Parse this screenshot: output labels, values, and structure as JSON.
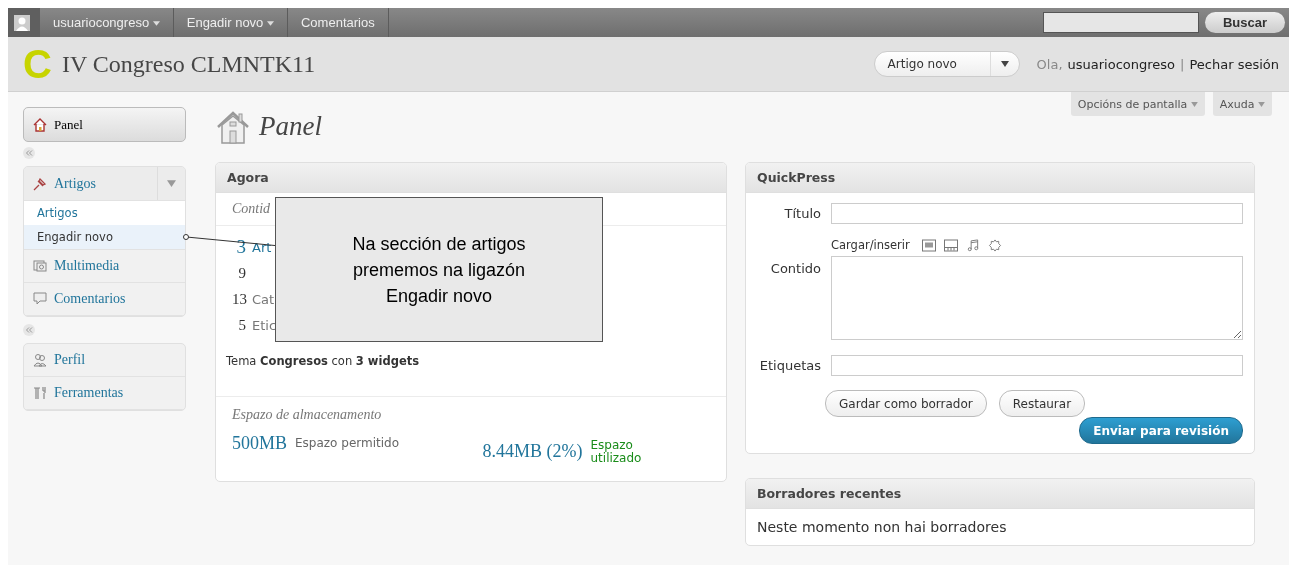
{
  "admin_bar": {
    "user": "usuariocongreso",
    "menus": [
      {
        "label": "Engadir novo",
        "dropdown": true
      },
      {
        "label": "Comentarios",
        "dropdown": false
      }
    ],
    "search_button": "Buscar"
  },
  "header": {
    "logo": "C",
    "site_title": "IV Congreso CLMNTK11",
    "quick_action": "Artigo novo",
    "greeting": "Ola,",
    "user": "usuariocongreso",
    "separator": "|",
    "logout": "Pechar sesión"
  },
  "screen_tabs": [
    "Opcións de pantalla",
    "Axuda"
  ],
  "page_title": "Panel",
  "sidebar": {
    "panel": {
      "label": "Panel",
      "selected": true
    },
    "groups": [
      [
        {
          "label": "Artigos",
          "kind": "pin",
          "expanded": true,
          "children": [
            {
              "label": "Artigos",
              "selected": false
            },
            {
              "label": "Engadir novo",
              "selected": true
            }
          ]
        },
        {
          "label": "Multimedia",
          "kind": "media",
          "expanded": false
        },
        {
          "label": "Comentarios",
          "kind": "comment",
          "expanded": false
        }
      ],
      [
        {
          "label": "Perfil",
          "kind": "users",
          "expanded": false
        },
        {
          "label": "Ferramentas",
          "kind": "tools",
          "expanded": false
        }
      ]
    ]
  },
  "agora": {
    "title": "Agora",
    "subtitle": "Contid",
    "rows": [
      {
        "count": "3",
        "label": "Art",
        "big": true
      },
      {
        "count": "9",
        "big": false
      },
      {
        "count": "13",
        "label": "Cat",
        "big": false
      },
      {
        "count": "5",
        "label": "Etic",
        "big": false
      }
    ],
    "theme": "Tema **Congresos** con **3 widgets**",
    "storage_title": "Espazo de almacenamento",
    "allowed": "500MB",
    "allowed_label": "Espazo permitido",
    "used": "8.44MB (2%)",
    "used_label": [
      "Espazo",
      "utilizado"
    ]
  },
  "callout": {
    "lines": [
      "Na sección de artigos",
      "prememos na ligazón",
      "Engadir novo"
    ]
  },
  "quickpress": {
    "title": "QuickPress",
    "title_label": "Título",
    "upload_label": "Cargar/inserir",
    "content_label": "Contido",
    "tags_label": "Etiquetas",
    "buttons": [
      "Gardar como borrador",
      "Restaurar"
    ],
    "submit": "Enviar para revisión"
  },
  "drafts": {
    "title": "Borradores recentes",
    "message": "Neste momento non hai borradores"
  }
}
